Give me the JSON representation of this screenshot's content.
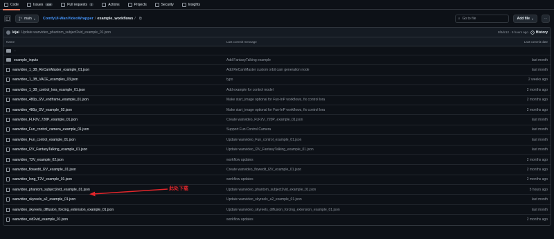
{
  "nav": {
    "tabs": [
      {
        "label": "Code",
        "icon": "code-icon",
        "count": null,
        "active": true
      },
      {
        "label": "Issues",
        "icon": "issue-icon",
        "count": "409",
        "active": false
      },
      {
        "label": "Pull requests",
        "icon": "pull-request-icon",
        "count": "2",
        "active": false
      },
      {
        "label": "Actions",
        "icon": "play-icon",
        "count": null,
        "active": false
      },
      {
        "label": "Projects",
        "icon": "table-icon",
        "count": null,
        "active": false
      },
      {
        "label": "Security",
        "icon": "shield-icon",
        "count": null,
        "active": false
      },
      {
        "label": "Insights",
        "icon": "graph-icon",
        "count": null,
        "active": false
      }
    ]
  },
  "path": {
    "branch": "main",
    "repo": "ComfyUI-WanVideoWrapper",
    "folder": "example_workflows",
    "sep": "/",
    "goto_placeholder": "Go to file",
    "add_file": "Add file",
    "more": "···"
  },
  "commit": {
    "author": "kijai",
    "message": "Update wanvideo_phantom_subject2vid_example_01.json",
    "meta": "9f4dc12 · 5 hours ago",
    "history": "History"
  },
  "table": {
    "headers": {
      "name": "Name",
      "message": "Last commit message",
      "date": "Last commit date"
    },
    "parent": "..",
    "rows": [
      {
        "type": "folder",
        "name": "example_inputs",
        "message": "Add FantasyTalking example",
        "date": "last month"
      },
      {
        "type": "file",
        "name": "wanvideo_1_3B_ReCamMaster_example_01.json",
        "message": "Add ReCamMaster custom orbit cam generation node",
        "date": "last month"
      },
      {
        "type": "file",
        "name": "wanvideo_1_3B_VACE_examples_03.json",
        "message": "typo",
        "date": "2 weeks ago"
      },
      {
        "type": "file",
        "name": "wanvideo_1_3B_control_lora_example_01.json",
        "message": "Add example for control model",
        "date": "2 months ago"
      },
      {
        "type": "file",
        "name": "wanvideo_480p_I2V_endframe_example_01.json",
        "message": "Make start_image optional for Fun-InP workflows, fix control lora",
        "date": "2 months ago"
      },
      {
        "type": "file",
        "name": "wanvideo_480p_I2V_example_02.json",
        "message": "Make start_image optional for Fun-InP workflows, fix control lora",
        "date": "2 months ago"
      },
      {
        "type": "file",
        "name": "wanvideo_FLF2V_720P_example_01.json",
        "message": "Create wanvideo_FLF2V_720P_example_01.json",
        "date": "last month"
      },
      {
        "type": "file",
        "name": "wanvideo_Fun_control_camera_example_01.json",
        "message": "Support Fun Control Camera",
        "date": "last month"
      },
      {
        "type": "file",
        "name": "wanvideo_Fun_control_example_01.json",
        "message": "Update wanvideo_Fun_control_example_01.json",
        "date": "last month"
      },
      {
        "type": "file",
        "name": "wanvideo_I2V_FantasyTalking_example_01.json",
        "message": "Update wanvideo_I2V_FantasyTalking_example_01.json",
        "date": "last month"
      },
      {
        "type": "file",
        "name": "wanvideo_T2V_example_02.json",
        "message": "workflow updates",
        "date": "2 months ago"
      },
      {
        "type": "file",
        "name": "wanvideo_flowedit_I2V_example_01.json",
        "message": "Create wanvideo_flowedit_I2V_example_01.json",
        "date": "2 months ago"
      },
      {
        "type": "file",
        "name": "wanvideo_long_T2V_example_01.json",
        "message": "workflow updates",
        "date": "2 months ago"
      },
      {
        "type": "file",
        "name": "wanvideo_phantom_subject2vid_example_01.json",
        "message": "Update wanvideo_phantom_subject2vid_example_01.json",
        "date": "5 hours ago"
      },
      {
        "type": "file",
        "name": "wanvideo_skyreels_a2_example_01.json",
        "message": "Update wanvideo_skyreels_a2_example_01.json",
        "date": "last month"
      },
      {
        "type": "file",
        "name": "wanvideo_skyreels_diffusion_forcing_extension_example_01.json",
        "message": "Update wanvideo_skyreels_diffusion_forcing_extension_example_01.json",
        "date": "last month"
      },
      {
        "type": "file",
        "name": "wanvideo_vid2vid_example_01.json",
        "message": "workflow updates",
        "date": "2 months ago"
      }
    ]
  },
  "annotation": {
    "text": "此处下载",
    "color": "#e3262b"
  }
}
